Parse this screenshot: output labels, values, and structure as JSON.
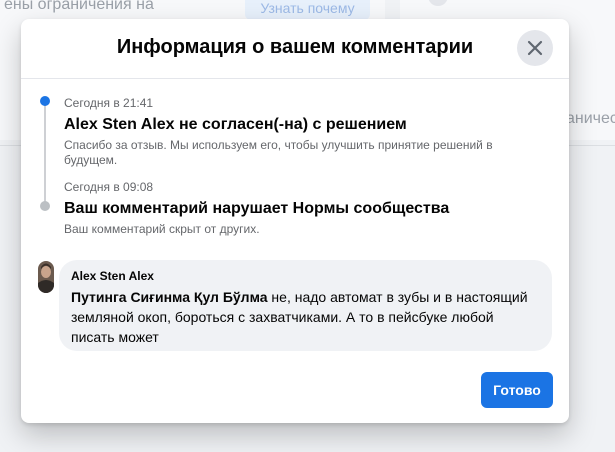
{
  "background": {
    "left_text": "ены ограничения на",
    "button_label": "Узнать почему",
    "right_text": "аничес"
  },
  "modal": {
    "title": "Информация о вашем комментарии",
    "close_icon": "close-icon",
    "events": [
      {
        "time": "Сегодня в 21:41",
        "title": "Alex Sten Alex не согласен(-на) с решением",
        "description": "Спасибо за отзыв. Мы используем его, чтобы улучшить принятие решений в будущем.",
        "status": "active"
      },
      {
        "time": "Сегодня в 09:08",
        "title": "Ваш комментарий нарушает Нормы сообщества",
        "description": "Ваш комментарий скрыт от других.",
        "status": "inactive"
      }
    ],
    "comment": {
      "author": "Alex Sten Alex",
      "mention": "Путинга Сиғинма Қул Бўлма",
      "text": " не, надо автомат в зубы и в настоящий земляной окоп, бороться с захватчиками. А то в пейсбуке любой писать может"
    },
    "done_label": "Готово"
  },
  "colors": {
    "accent": "#1b74e4",
    "bubble": "#f0f2f5",
    "secondary_text": "#65676b"
  }
}
